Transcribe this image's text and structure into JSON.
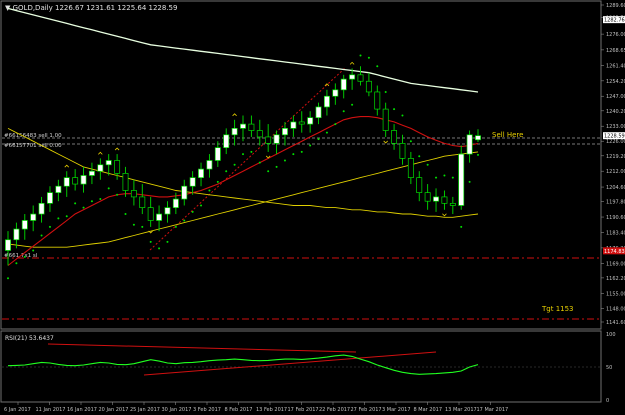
{
  "symbol_header": "▼ GOLD,Daily  1226.67 1231.61 1225.64 1228.59",
  "main_chart": {
    "price_levels": [
      "1289.60",
      "1283.70",
      "1276.00",
      "1268.65",
      "1261.40",
      "1254.20",
      "1247.00",
      "1240.20",
      "1233.00",
      "1226.00",
      "1219.20",
      "1212.00",
      "1204.60",
      "1197.80",
      "1190.60",
      "1183.40",
      "1176.20",
      "1169.00",
      "1162.20",
      "1155.00",
      "1148.00",
      "1141.60"
    ],
    "price_badges": [
      "1282.76",
      "1228.59",
      "1174.83"
    ],
    "order_labels": [
      "#66156483 sell 1.00",
      "#66157701 sell 0.00",
      "#661   7x1 sl"
    ],
    "annotations": [
      "Sell Here",
      "Tgt 1153"
    ],
    "candles": [
      [
        1175,
        1184,
        1168,
        1180
      ],
      [
        1180,
        1188,
        1176,
        1185
      ],
      [
        1185,
        1192,
        1180,
        1189
      ],
      [
        1189,
        1196,
        1184,
        1192
      ],
      [
        1192,
        1200,
        1188,
        1197
      ],
      [
        1197,
        1205,
        1193,
        1202
      ],
      [
        1202,
        1208,
        1198,
        1205
      ],
      [
        1205,
        1212,
        1200,
        1209
      ],
      [
        1209,
        1213,
        1203,
        1206
      ],
      [
        1206,
        1214,
        1202,
        1210
      ],
      [
        1210,
        1216,
        1206,
        1212
      ],
      [
        1212,
        1218,
        1208,
        1215
      ],
      [
        1215,
        1220,
        1210,
        1217
      ],
      [
        1217,
        1220,
        1208,
        1211
      ],
      [
        1211,
        1214,
        1200,
        1203
      ],
      [
        1203,
        1208,
        1196,
        1200
      ],
      [
        1200,
        1206,
        1192,
        1195
      ],
      [
        1195,
        1200,
        1186,
        1189
      ],
      [
        1189,
        1196,
        1184,
        1192
      ],
      [
        1192,
        1198,
        1188,
        1195
      ],
      [
        1195,
        1202,
        1192,
        1199
      ],
      [
        1199,
        1208,
        1196,
        1205
      ],
      [
        1205,
        1212,
        1201,
        1209
      ],
      [
        1209,
        1216,
        1205,
        1213
      ],
      [
        1213,
        1220,
        1209,
        1217
      ],
      [
        1217,
        1226,
        1214,
        1223
      ],
      [
        1223,
        1232,
        1220,
        1229
      ],
      [
        1229,
        1236,
        1224,
        1232
      ],
      [
        1232,
        1238,
        1226,
        1234
      ],
      [
        1234,
        1238,
        1228,
        1231
      ],
      [
        1231,
        1236,
        1224,
        1228
      ],
      [
        1228,
        1234,
        1221,
        1225
      ],
      [
        1225,
        1231,
        1220,
        1229
      ],
      [
        1229,
        1235,
        1224,
        1232
      ],
      [
        1232,
        1238,
        1228,
        1235
      ],
      [
        1235,
        1240,
        1230,
        1234
      ],
      [
        1234,
        1240,
        1230,
        1237
      ],
      [
        1237,
        1244,
        1234,
        1242
      ],
      [
        1242,
        1250,
        1238,
        1247
      ],
      [
        1247,
        1253,
        1243,
        1250
      ],
      [
        1250,
        1257,
        1246,
        1255
      ],
      [
        1255,
        1260,
        1250,
        1257
      ],
      [
        1257,
        1261,
        1252,
        1254
      ],
      [
        1254,
        1258,
        1247,
        1249
      ],
      [
        1249,
        1252,
        1238,
        1241
      ],
      [
        1241,
        1244,
        1228,
        1231
      ],
      [
        1231,
        1234,
        1222,
        1225
      ],
      [
        1225,
        1229,
        1215,
        1218
      ],
      [
        1218,
        1221,
        1206,
        1209
      ],
      [
        1209,
        1212,
        1198,
        1202
      ],
      [
        1202,
        1206,
        1194,
        1198
      ],
      [
        1198,
        1204,
        1193,
        1200
      ],
      [
        1200,
        1203,
        1194,
        1197
      ],
      [
        1197,
        1200,
        1192,
        1196
      ],
      [
        1196,
        1224,
        1194,
        1220
      ],
      [
        1220,
        1231,
        1216,
        1229
      ],
      [
        1226.67,
        1231.61,
        1225.64,
        1228.59
      ]
    ],
    "ma_white": [
      1288,
      1287,
      1286,
      1285,
      1284,
      1283,
      1282,
      1281,
      1280,
      1279,
      1278,
      1277,
      1276,
      1275,
      1274,
      1273,
      1272,
      1271,
      1270.5,
      1270,
      1269.5,
      1269,
      1268.5,
      1268,
      1267.5,
      1267,
      1266.5,
      1266,
      1265.5,
      1265,
      1264.5,
      1264,
      1263.5,
      1263,
      1262.5,
      1262,
      1261.5,
      1261,
      1260.5,
      1260,
      1259.5,
      1259,
      1258.5,
      1258,
      1257,
      1256,
      1255,
      1254,
      1253,
      1252.5,
      1252,
      1251.5,
      1251,
      1250.5,
      1250,
      1249.5,
      1249
    ],
    "ma_yellow": [
      1232,
      1230,
      1228,
      1226,
      1224,
      1222,
      1220,
      1218,
      1216,
      1214,
      1213,
      1212,
      1211,
      1210,
      1209,
      1208,
      1207,
      1206,
      1205,
      1204,
      1203,
      1202.5,
      1202,
      1201.5,
      1201,
      1200.5,
      1200,
      1199.5,
      1199,
      1198.5,
      1198,
      1197.5,
      1197,
      1196.5,
      1196,
      1196,
      1196,
      1195.5,
      1195,
      1195,
      1194.5,
      1194,
      1194,
      1193.5,
      1193,
      1193,
      1192.5,
      1192,
      1192,
      1191.5,
      1191,
      1191,
      1190.5,
      1190.5,
      1191,
      1191.5,
      1192
    ],
    "ma_lower": [
      1178,
      1177.5,
      1177,
      1176.5,
      1176.5,
      1176.5,
      1176.5,
      1176.5,
      1177,
      1177.5,
      1178,
      1178.5,
      1179,
      1180,
      1181,
      1182,
      1183,
      1184,
      1185,
      1186,
      1187,
      1188,
      1189,
      1190,
      1191,
      1192,
      1193,
      1194,
      1195,
      1196,
      1197,
      1198,
      1199,
      1200,
      1201,
      1202,
      1203,
      1204,
      1205,
      1206,
      1207,
      1208,
      1209,
      1210,
      1211,
      1212,
      1213,
      1214,
      1215,
      1216,
      1217,
      1218,
      1219,
      1219.5,
      1220,
      1220.5,
      1221
    ],
    "ma_red": [
      1168,
      1171,
      1174,
      1177,
      1180,
      1183,
      1186,
      1189,
      1192,
      1194,
      1196,
      1198,
      1200,
      1201,
      1201.5,
      1201.5,
      1201,
      1200.5,
      1200,
      1200,
      1200.5,
      1201,
      1202,
      1203,
      1204.5,
      1206,
      1208,
      1210,
      1212,
      1214,
      1216,
      1218,
      1220,
      1222,
      1224,
      1226,
      1228,
      1230,
      1232,
      1234,
      1236,
      1237,
      1237.5,
      1237.5,
      1237,
      1236,
      1235,
      1233.5,
      1232,
      1230,
      1228,
      1226.5,
      1225,
      1224,
      1223.5,
      1224,
      1225
    ]
  },
  "rsi_panel": {
    "label": "RSI(21) 53.6437",
    "levels": [
      "100",
      "50",
      "0"
    ],
    "values": [
      52,
      52.5,
      53,
      55,
      57,
      56,
      54,
      52.5,
      52,
      53,
      55,
      57,
      56,
      54,
      53.5,
      55,
      58,
      61,
      59,
      56,
      55,
      56.5,
      57,
      58,
      59.5,
      60.5,
      61,
      62,
      61,
      60,
      59.5,
      60,
      61,
      62,
      62,
      61.5,
      62.5,
      63.5,
      65,
      67,
      68,
      66,
      62,
      58,
      53,
      49,
      45,
      42,
      40,
      39,
      39.5,
      40,
      41,
      42,
      44,
      50,
      53.64
    ]
  },
  "time_axis": [
    "6 Jan 2017",
    "11 Jan 2017",
    "16 Jan 2017",
    "20 Jan 2017",
    "25 Jan 2017",
    "30 Jan 2017",
    "3 Feb 2017",
    "8 Feb 2017",
    "13 Feb 2017",
    "17 Feb 2017",
    "22 Feb 2017",
    "27 Feb 2017",
    "3 Mar 2017",
    "8 Mar 2017",
    "13 Mar 2017",
    "17 Mar 2017"
  ],
  "colors": {
    "background": "#000000",
    "bull_candle": "#ffffff",
    "bear_candle": "#000000",
    "candle_outline": "#00dd00",
    "ma_white": "#e8ffe0",
    "ma_yellow": "#e0d000",
    "ma_red": "#d01010",
    "sar_dots": "#00e000",
    "rsi_line": "#20ff20",
    "rsi_trend": "#d01010",
    "annotation": "#e8d000",
    "axis_text": "#c0c0c0"
  }
}
